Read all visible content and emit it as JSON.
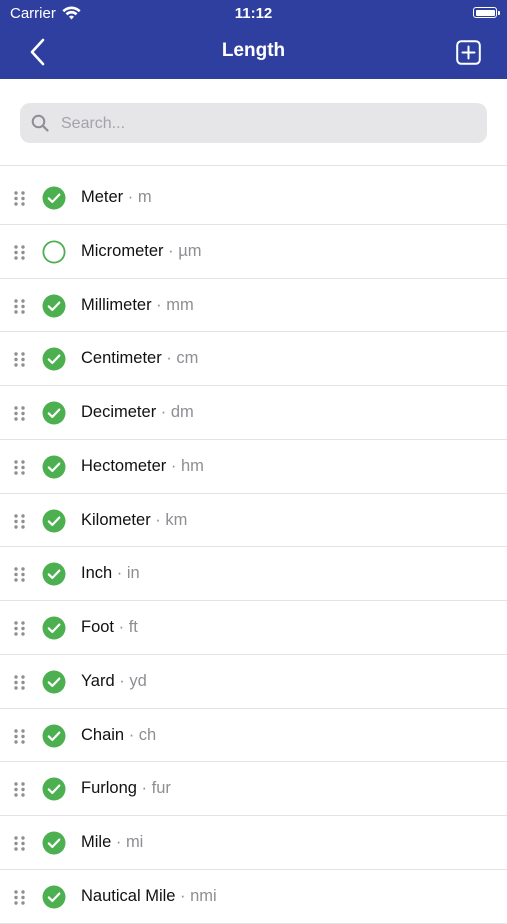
{
  "status_bar": {
    "carrier": "Carrier",
    "time": "11:12"
  },
  "nav": {
    "title": "Length",
    "back_icon": "chevron-left-icon",
    "add_icon": "plus-square-icon"
  },
  "search": {
    "placeholder": "Search...",
    "value": ""
  },
  "colors": {
    "header": "#2f3f9f",
    "check": "#4caf50",
    "separator": "#e3e3e6"
  },
  "units": [
    {
      "name": "Meter",
      "symbol": "m",
      "enabled": true
    },
    {
      "name": "Micrometer",
      "symbol": "µm",
      "enabled": false
    },
    {
      "name": "Millimeter",
      "symbol": "mm",
      "enabled": true
    },
    {
      "name": "Centimeter",
      "symbol": "cm",
      "enabled": true
    },
    {
      "name": "Decimeter",
      "symbol": "dm",
      "enabled": true
    },
    {
      "name": "Hectometer",
      "symbol": "hm",
      "enabled": true
    },
    {
      "name": "Kilometer",
      "symbol": "km",
      "enabled": true
    },
    {
      "name": "Inch",
      "symbol": "in",
      "enabled": true
    },
    {
      "name": "Foot",
      "symbol": "ft",
      "enabled": true
    },
    {
      "name": "Yard",
      "symbol": "yd",
      "enabled": true
    },
    {
      "name": "Chain",
      "symbol": "ch",
      "enabled": true
    },
    {
      "name": "Furlong",
      "symbol": "fur",
      "enabled": true
    },
    {
      "name": "Mile",
      "symbol": "mi",
      "enabled": true
    },
    {
      "name": "Nautical Mile",
      "symbol": "nmi",
      "enabled": true
    }
  ],
  "separator": " · "
}
